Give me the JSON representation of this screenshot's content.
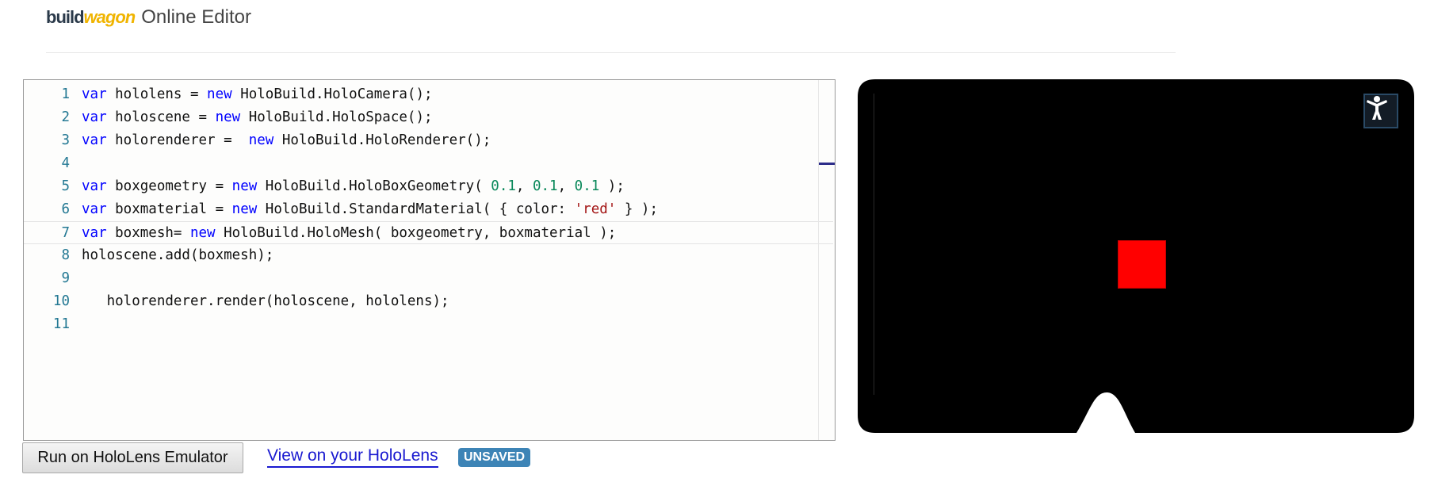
{
  "header": {
    "logo_build": "build",
    "logo_wagon": "wagon",
    "app_name": "Online Editor"
  },
  "editor": {
    "current_line": 7,
    "lines": [
      {
        "no": "1",
        "tokens": [
          [
            "kw",
            "var"
          ],
          [
            "t",
            " hololens = "
          ],
          [
            "kw",
            "new"
          ],
          [
            "t",
            " HoloBuild.HoloCamera();"
          ]
        ]
      },
      {
        "no": "2",
        "tokens": [
          [
            "kw",
            "var"
          ],
          [
            "t",
            " holoscene = "
          ],
          [
            "kw",
            "new"
          ],
          [
            "t",
            " HoloBuild.HoloSpace();"
          ]
        ]
      },
      {
        "no": "3",
        "tokens": [
          [
            "kw",
            "var"
          ],
          [
            "t",
            " holorenderer =  "
          ],
          [
            "kw",
            "new"
          ],
          [
            "t",
            " HoloBuild.HoloRenderer();"
          ]
        ]
      },
      {
        "no": "4",
        "tokens": []
      },
      {
        "no": "5",
        "tokens": [
          [
            "kw",
            "var"
          ],
          [
            "t",
            " boxgeometry = "
          ],
          [
            "kw",
            "new"
          ],
          [
            "t",
            " HoloBuild.HoloBoxGeometry( "
          ],
          [
            "num",
            "0.1"
          ],
          [
            "t",
            ", "
          ],
          [
            "num",
            "0.1"
          ],
          [
            "t",
            ", "
          ],
          [
            "num",
            "0.1"
          ],
          [
            "t",
            " );"
          ]
        ]
      },
      {
        "no": "6",
        "tokens": [
          [
            "kw",
            "var"
          ],
          [
            "t",
            " boxmaterial = "
          ],
          [
            "kw",
            "new"
          ],
          [
            "t",
            " HoloBuild.StandardMaterial( { color: "
          ],
          [
            "str",
            "'red'"
          ],
          [
            "t",
            " } );"
          ]
        ]
      },
      {
        "no": "7",
        "tokens": [
          [
            "kw",
            "var"
          ],
          [
            "t",
            " boxmesh= "
          ],
          [
            "kw",
            "new"
          ],
          [
            "t",
            " HoloBuild.HoloMesh( boxgeometry, boxmaterial );"
          ]
        ]
      },
      {
        "no": "8",
        "tokens": [
          [
            "t",
            "holoscene.add(boxmesh);"
          ]
        ]
      },
      {
        "no": "9",
        "tokens": []
      },
      {
        "no": "10",
        "tokens": [
          [
            "t",
            "   holorenderer.render(holoscene, hololens);"
          ]
        ]
      },
      {
        "no": "11",
        "tokens": []
      }
    ]
  },
  "actions": {
    "run_label": "Run on HoloLens Emulator",
    "view_label": "View on your HoloLens",
    "status_badge": "UNSAVED"
  },
  "preview": {
    "background": "#000000",
    "cube_color": "#ff0000",
    "vr_icon": "accessibility-person-icon"
  },
  "colors": {
    "keyword": "#0000ff",
    "number": "#09885a",
    "string": "#a31515",
    "line_number": "#237893",
    "link": "#1a1ad0",
    "badge": "#3d84b6"
  }
}
